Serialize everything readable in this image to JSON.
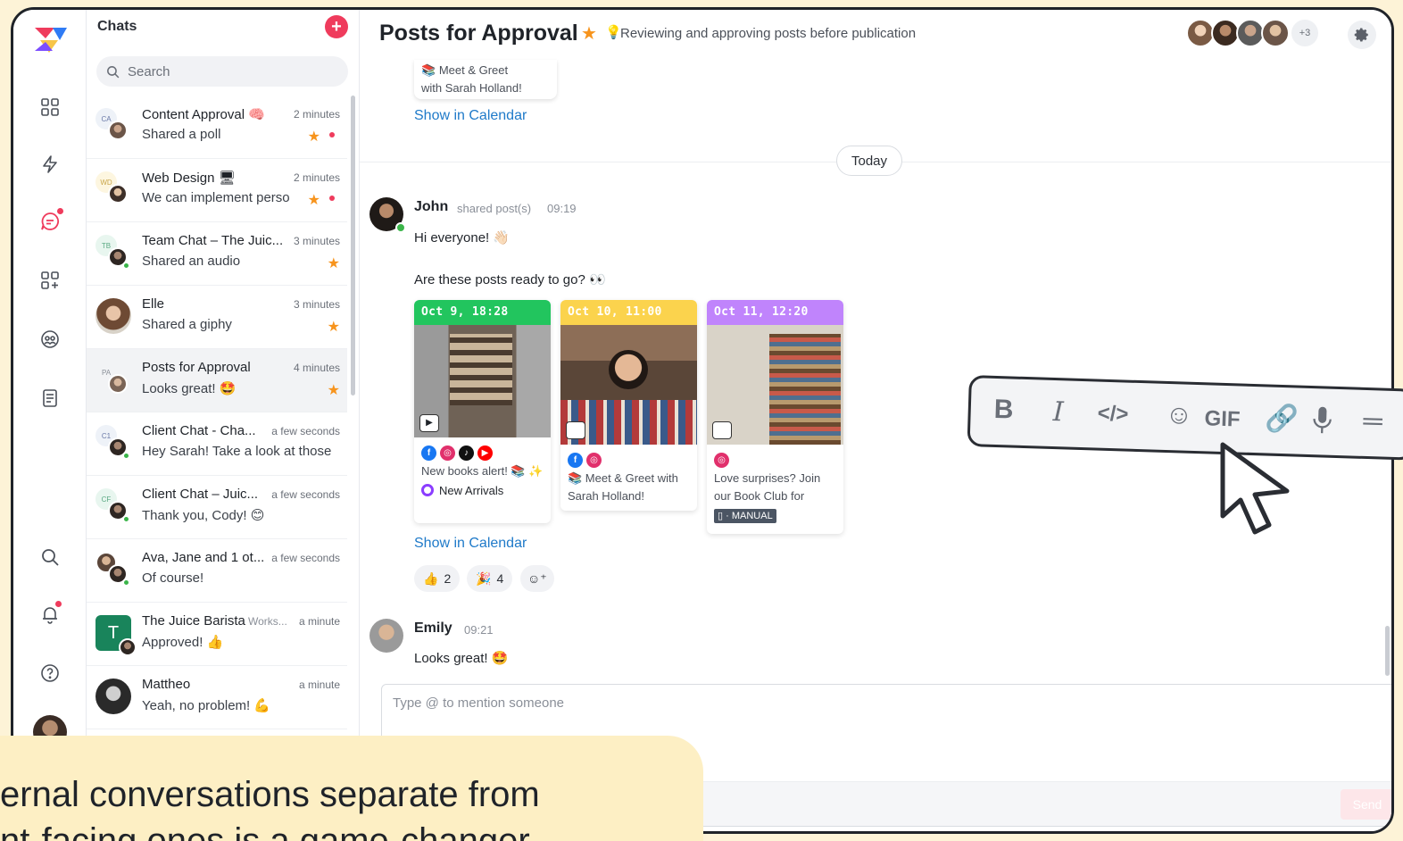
{
  "chat_list": {
    "title": "Chats",
    "search_placeholder": "Search",
    "items": [
      {
        "initials": "CA",
        "name": "Content Approval 🧠",
        "time": "2 minutes",
        "message": "Shared a poll",
        "starred": true,
        "unread": true
      },
      {
        "initials": "WD",
        "name": "Web Design 🖥",
        "time": "2 minutes",
        "message": "We can implement perso",
        "starred": true,
        "unread": true
      },
      {
        "initials": "TB",
        "name": "Team Chat – The Juic...",
        "time": "3 minutes",
        "message": "Shared an audio",
        "starred": true,
        "unread": false
      },
      {
        "initials": "",
        "name": "Elle",
        "time": "3 minutes",
        "message": "Shared a giphy",
        "starred": true,
        "unread": false
      },
      {
        "initials": "PA",
        "name": "Posts for Approval",
        "time": "4 minutes",
        "message": "Looks great! 🤩",
        "starred": true,
        "unread": false
      },
      {
        "initials": "C1",
        "name": "Client Chat - Cha...",
        "time": "a few seconds",
        "message": "Hey Sarah! Take a look at those",
        "starred": false,
        "unread": false
      },
      {
        "initials": "CF",
        "name": "Client Chat – Juic...",
        "time": "a few seconds",
        "message": "Thank you, Cody! 😊",
        "starred": false,
        "unread": false
      },
      {
        "initials": "",
        "name": "Ava, Jane and 1 ot...",
        "time": "a few seconds",
        "message": "Of course!",
        "starred": false,
        "unread": false
      },
      {
        "initials": "T",
        "name": "The Juice Barista",
        "workspace": "Works...",
        "time": "a minute",
        "message": "Approved! 👍",
        "starred": false,
        "unread": false
      },
      {
        "initials": "",
        "name": "Mattheo",
        "time": "a minute",
        "message": "Yeah, no problem! 💪",
        "starred": false,
        "unread": false
      }
    ]
  },
  "header": {
    "title": "Posts for Approval",
    "description": "Reviewing and approving posts before publication",
    "extra_members": "+3"
  },
  "previous_post": {
    "text_line1": "Meet & Greet",
    "text_line2": "with Sarah Holland!",
    "calendar_link": "Show in Calendar"
  },
  "day_separator": "Today",
  "messages": [
    {
      "author": "John",
      "action": "shared post(s)",
      "time": "09:19",
      "lines": [
        "Hi everyone! 👋🏻",
        "Are these posts ready to go? 👀"
      ],
      "posts": [
        {
          "date": "Oct 9, 18:28",
          "color": "#22c55e",
          "text": "New books alert! 📚 ✨",
          "tag": "New Arrivals"
        },
        {
          "date": "Oct 10, 11:00",
          "color": "#fbd34d",
          "text": "📚 Meet & Greet with Sarah Holland!",
          "tag": ""
        },
        {
          "date": "Oct 11, 12:20",
          "color": "#c084fc",
          "text": "Love surprises? Join our Book Club for",
          "tag": "MANUAL"
        }
      ],
      "calendar_link": "Show in Calendar",
      "reactions": [
        {
          "emoji": "👍",
          "count": "2"
        },
        {
          "emoji": "🎉",
          "count": "4"
        }
      ]
    },
    {
      "author": "Emily",
      "time": "09:21",
      "lines": [
        "Looks great! 🤩"
      ]
    }
  ],
  "composer": {
    "placeholder": "Type @ to mention someone",
    "send_label": "Send"
  },
  "format_toolbar": {
    "bold": "B",
    "italic": "I",
    "code": "</>",
    "gif": "GIF"
  },
  "caption": {
    "line1": "ernal conversations separate from",
    "line2": "nt-facing ones is a game-changer"
  },
  "colors": {
    "accent": "#ef3b5c",
    "link": "#1f7ac9",
    "star": "#f7941d",
    "caption_bg": "#fdefc4"
  }
}
